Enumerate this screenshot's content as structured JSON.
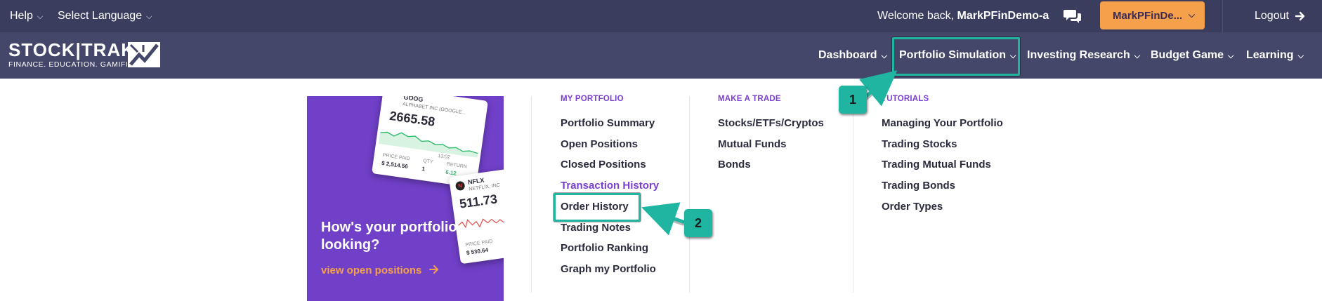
{
  "topbar": {
    "help": "Help",
    "language": "Select Language",
    "welcome_prefix": "Welcome back,",
    "username": "MarkPFinDemo-a",
    "account_button": "MarkPFinDe...",
    "logout": "Logout"
  },
  "brand": {
    "logo_name": "STOCK|TRAK",
    "tagline": "FINANCE. EDUCATION. GAMIFIED."
  },
  "nav": {
    "items": [
      {
        "label": "Dashboard"
      },
      {
        "label": "Portfolio Simulation"
      },
      {
        "label": "Investing Research"
      },
      {
        "label": "Budget Game"
      },
      {
        "label": "Learning"
      }
    ]
  },
  "promo": {
    "title": "How's your portfolio looking?",
    "link": "view open positions",
    "card1": {
      "ticker": "GOOG",
      "name": "ALPHABET INC (GOOGLE...",
      "price": "2665.58",
      "time": "13:02",
      "price_paid_label": "PRICE PAID",
      "price_paid": "$ 2,514.56",
      "qty_label": "QTY",
      "qty": "1",
      "return_label": "RETURN",
      "return_value": "6.12"
    },
    "card2": {
      "ticker": "NFLX",
      "name": "NETFLIX, INC",
      "price": "511.73",
      "price_paid_label": "PRICE PAID",
      "price_paid": "$ 530.64"
    }
  },
  "menu": {
    "my_portfolio": {
      "heading": "MY PORTFOLIO",
      "links": [
        "Portfolio Summary",
        "Open Positions",
        "Closed Positions",
        "Transaction History",
        "Order History",
        "Trading Notes",
        "Portfolio Ranking",
        "Graph my Portfolio"
      ]
    },
    "make_a_trade": {
      "heading": "MAKE A TRADE",
      "links": [
        "Stocks/ETFs/Cryptos",
        "Mutual Funds",
        "Bonds"
      ]
    },
    "tutorials": {
      "heading": "TUTORIALS",
      "links": [
        "Managing Your Portfolio",
        "Trading Stocks",
        "Trading Mutual Funds",
        "Trading Bonds",
        "Order Types"
      ]
    }
  },
  "annotations": {
    "step1": "1",
    "step2": "2"
  },
  "colors": {
    "topbar_bg": "#3b3d5e",
    "navbar_bg": "#44466a",
    "accent_orange": "#f5a04a",
    "accent_purple": "#7b3fd0",
    "promo_bg": "#7040c8",
    "highlight_teal": "#1fb5a0"
  }
}
